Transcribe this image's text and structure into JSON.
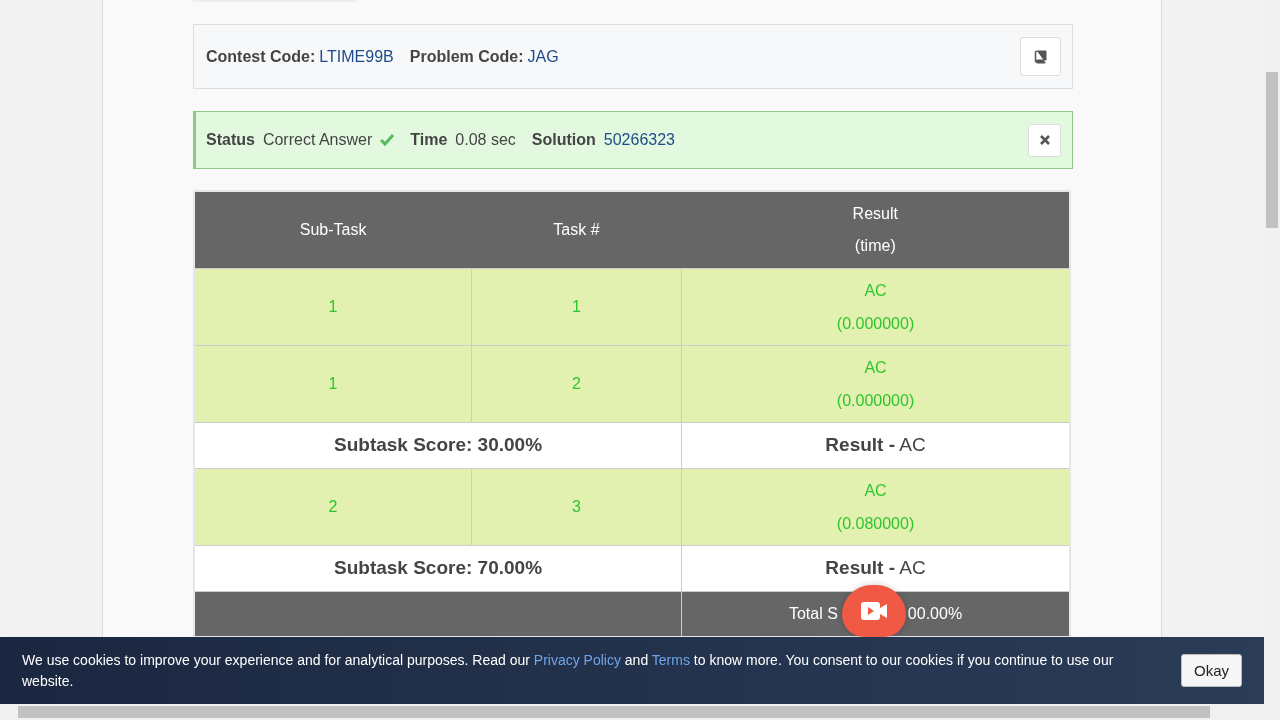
{
  "problem_bar": {
    "contest_label": "Contest Code:",
    "contest_code": "LTIME99B",
    "problem_label": "Problem Code:",
    "problem_code": "JAG"
  },
  "status_bar": {
    "status_label": "Status",
    "status_value": "Correct Answer",
    "accepted": true,
    "time_label": "Time",
    "time_value": "0.08 sec",
    "solution_label": "Solution",
    "solution_id": "50266323"
  },
  "table": {
    "columns": [
      "Sub-Task",
      "Task #",
      "Result",
      "(time)"
    ],
    "rows": [
      {
        "kind": "task",
        "subtask": "1",
        "task": "1",
        "result": "AC",
        "time": "(0.000000)"
      },
      {
        "kind": "task",
        "subtask": "1",
        "task": "2",
        "result": "AC",
        "time": "(0.000000)"
      },
      {
        "kind": "score",
        "score": "Subtask Score: 30.00%",
        "result_label": "Result -",
        "result": "AC"
      },
      {
        "kind": "task",
        "subtask": "2",
        "task": "3",
        "result": "AC",
        "time": "(0.080000)"
      },
      {
        "kind": "score",
        "score": "Subtask Score: 70.00%",
        "result_label": "Result -",
        "result": "AC"
      }
    ],
    "total_visible_start": "Total S",
    "total_visible_end": "00.00%"
  },
  "cookie_banner": {
    "text_before": "We use cookies to improve your experience and for analytical purposes. Read our ",
    "privacy_link": "Privacy Policy",
    "text_middle": " and ",
    "terms_link": "Terms",
    "text_after": " to know more. You consent to our cookies if you continue to use our website.",
    "button": "Okay"
  }
}
